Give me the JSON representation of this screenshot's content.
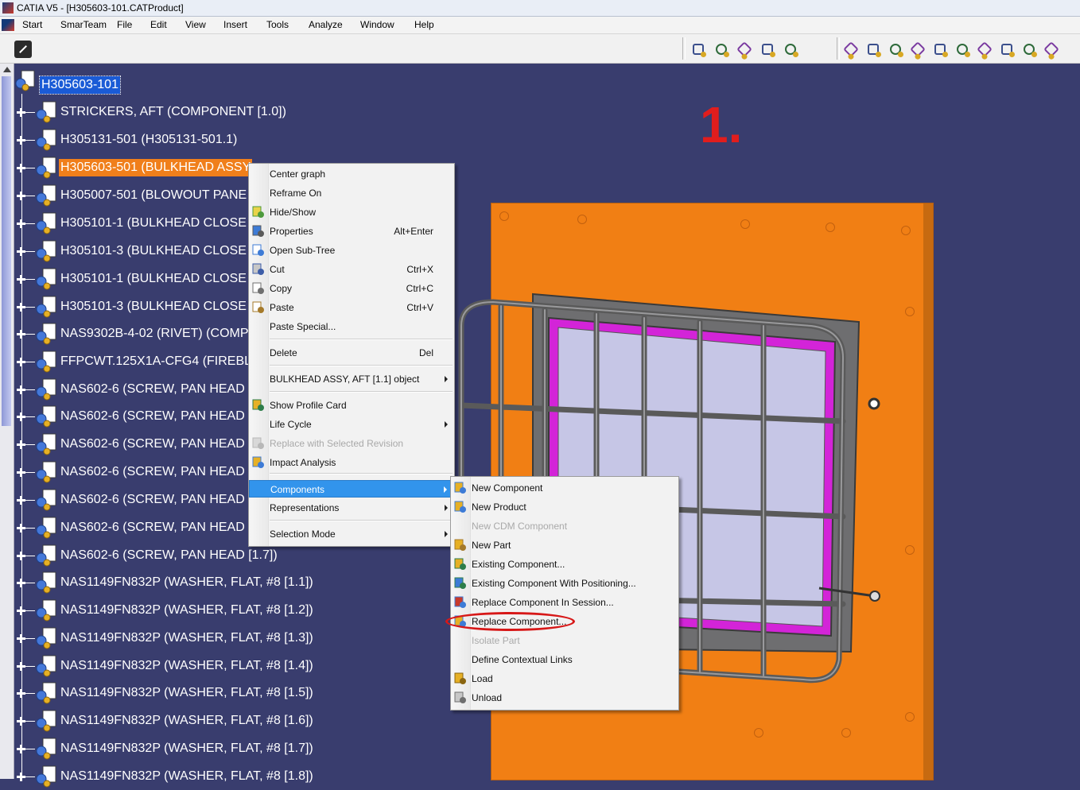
{
  "window": {
    "title": "CATIA V5 - [H305603-101.CATProduct]"
  },
  "menubar": {
    "items": [
      "Start",
      "SmarTeam",
      "File",
      "Edit",
      "View",
      "Insert",
      "Tools",
      "Analyze",
      "Window",
      "Help"
    ]
  },
  "tree": {
    "root": "H305603-101",
    "rows": [
      {
        "label": "STRICKERS, AFT (COMPONENT   [1.0])",
        "selected": false
      },
      {
        "label": "H305131-501 (H305131-501.1)",
        "selected": false
      },
      {
        "label": "H305603-501 (BULKHEAD ASSY",
        "selected": true
      },
      {
        "label": "H305007-501 (BLOWOUT PANE",
        "selected": false
      },
      {
        "label": "H305101-1 (BULKHEAD CLOSE",
        "selected": false
      },
      {
        "label": "H305101-3 (BULKHEAD CLOSE",
        "selected": false
      },
      {
        "label": "H305101-1 (BULKHEAD CLOSE",
        "selected": false
      },
      {
        "label": "H305101-3 (BULKHEAD CLOSE",
        "selected": false
      },
      {
        "label": "NAS9302B-4-02 (RIVET) (COMP",
        "selected": false
      },
      {
        "label": "FFPCWT.125X1A-CFG4 (FIREBL",
        "selected": false
      },
      {
        "label": "NAS602-6 (SCREW, PAN HEAD",
        "selected": false
      },
      {
        "label": "NAS602-6 (SCREW, PAN HEAD",
        "selected": false
      },
      {
        "label": "NAS602-6 (SCREW, PAN HEAD",
        "selected": false
      },
      {
        "label": "NAS602-6 (SCREW, PAN HEAD",
        "selected": false
      },
      {
        "label": "NAS602-6 (SCREW, PAN HEAD",
        "selected": false
      },
      {
        "label": "NAS602-6 (SCREW, PAN HEAD",
        "selected": false
      },
      {
        "label": "NAS602-6 (SCREW, PAN HEAD   [1.7])",
        "selected": false
      },
      {
        "label": "NAS1149FN832P (WASHER, FLAT, #8   [1.1])",
        "selected": false
      },
      {
        "label": "NAS1149FN832P (WASHER, FLAT, #8   [1.2])",
        "selected": false
      },
      {
        "label": "NAS1149FN832P (WASHER, FLAT, #8   [1.3])",
        "selected": false
      },
      {
        "label": "NAS1149FN832P (WASHER, FLAT, #8   [1.4])",
        "selected": false
      },
      {
        "label": "NAS1149FN832P (WASHER, FLAT, #8   [1.5])",
        "selected": false
      },
      {
        "label": "NAS1149FN832P (WASHER, FLAT, #8   [1.6])",
        "selected": false
      },
      {
        "label": "NAS1149FN832P (WASHER, FLAT, #8   [1.7])",
        "selected": false
      },
      {
        "label": "NAS1149FN832P (WASHER, FLAT, #8   [1.8])",
        "selected": false
      }
    ]
  },
  "annotation": {
    "step": "1."
  },
  "context_menu": {
    "items": [
      {
        "label": "Center graph",
        "shortcut": "",
        "icon": "",
        "disabled": false
      },
      {
        "label": "Reframe On",
        "shortcut": "",
        "icon": "",
        "disabled": false
      },
      {
        "label": "Hide/Show",
        "shortcut": "",
        "icon": "hide-show-icon",
        "disabled": false
      },
      {
        "label": "Properties",
        "shortcut": "Alt+Enter",
        "icon": "properties-icon",
        "disabled": false
      },
      {
        "label": "Open Sub-Tree",
        "shortcut": "",
        "icon": "open-subtree-icon",
        "disabled": false
      },
      {
        "label": "Cut",
        "shortcut": "Ctrl+X",
        "icon": "scissors-icon",
        "disabled": false
      },
      {
        "label": "Copy",
        "shortcut": "Ctrl+C",
        "icon": "copy-icon",
        "disabled": false
      },
      {
        "label": "Paste",
        "shortcut": "Ctrl+V",
        "icon": "paste-icon",
        "disabled": false
      },
      {
        "label": "Paste Special...",
        "shortcut": "",
        "icon": "",
        "disabled": false
      },
      {
        "label": "Delete",
        "shortcut": "Del",
        "icon": "",
        "disabled": false
      },
      {
        "label": "BULKHEAD ASSY, AFT  [1.1] object",
        "shortcut": "",
        "icon": "",
        "disabled": false,
        "submenu": true
      },
      {
        "label": "Show Profile Card",
        "shortcut": "",
        "icon": "profile-card-icon",
        "disabled": false
      },
      {
        "label": "Life Cycle",
        "shortcut": "",
        "icon": "",
        "disabled": false,
        "submenu": true
      },
      {
        "label": "Replace with Selected Revision",
        "shortcut": "",
        "icon": "replace-revision-icon",
        "disabled": true
      },
      {
        "label": "Impact Analysis",
        "shortcut": "",
        "icon": "impact-analysis-icon",
        "disabled": false
      },
      {
        "label": "Components",
        "shortcut": "",
        "icon": "",
        "disabled": false,
        "submenu": true,
        "highlighted": true
      },
      {
        "label": "Representations",
        "shortcut": "",
        "icon": "",
        "disabled": false,
        "submenu": true
      },
      {
        "label": "Selection Mode",
        "shortcut": "",
        "icon": "",
        "disabled": false,
        "submenu": true
      }
    ]
  },
  "components_submenu": {
    "items": [
      {
        "label": "New Component",
        "icon": "new-component-icon",
        "disabled": false
      },
      {
        "label": "New Product",
        "icon": "new-product-icon",
        "disabled": false
      },
      {
        "label": "New CDM Component",
        "icon": "",
        "disabled": true
      },
      {
        "label": "New Part",
        "icon": "new-part-icon",
        "disabled": false
      },
      {
        "label": "Existing Component...",
        "icon": "existing-component-icon",
        "disabled": false
      },
      {
        "label": "Existing Component With Positioning...",
        "icon": "existing-positioning-icon",
        "disabled": false
      },
      {
        "label": "Replace Component In Session...",
        "icon": "replace-session-icon",
        "disabled": false
      },
      {
        "label": "Replace Component...",
        "icon": "replace-component-icon",
        "disabled": false,
        "circled": true
      },
      {
        "label": "Isolate Part",
        "icon": "",
        "disabled": true
      },
      {
        "label": "Define Contextual Links",
        "icon": "",
        "disabled": false
      },
      {
        "label": "Load",
        "icon": "load-icon",
        "disabled": false
      },
      {
        "label": "Unload",
        "icon": "unload-icon",
        "disabled": false
      }
    ]
  },
  "colors": {
    "background": "#393d6e",
    "selection": "#f07f1b",
    "highlight": "#3294ec",
    "annotation": "#e11d1d",
    "panel": "#f17f14",
    "frame": "#d324d8"
  }
}
